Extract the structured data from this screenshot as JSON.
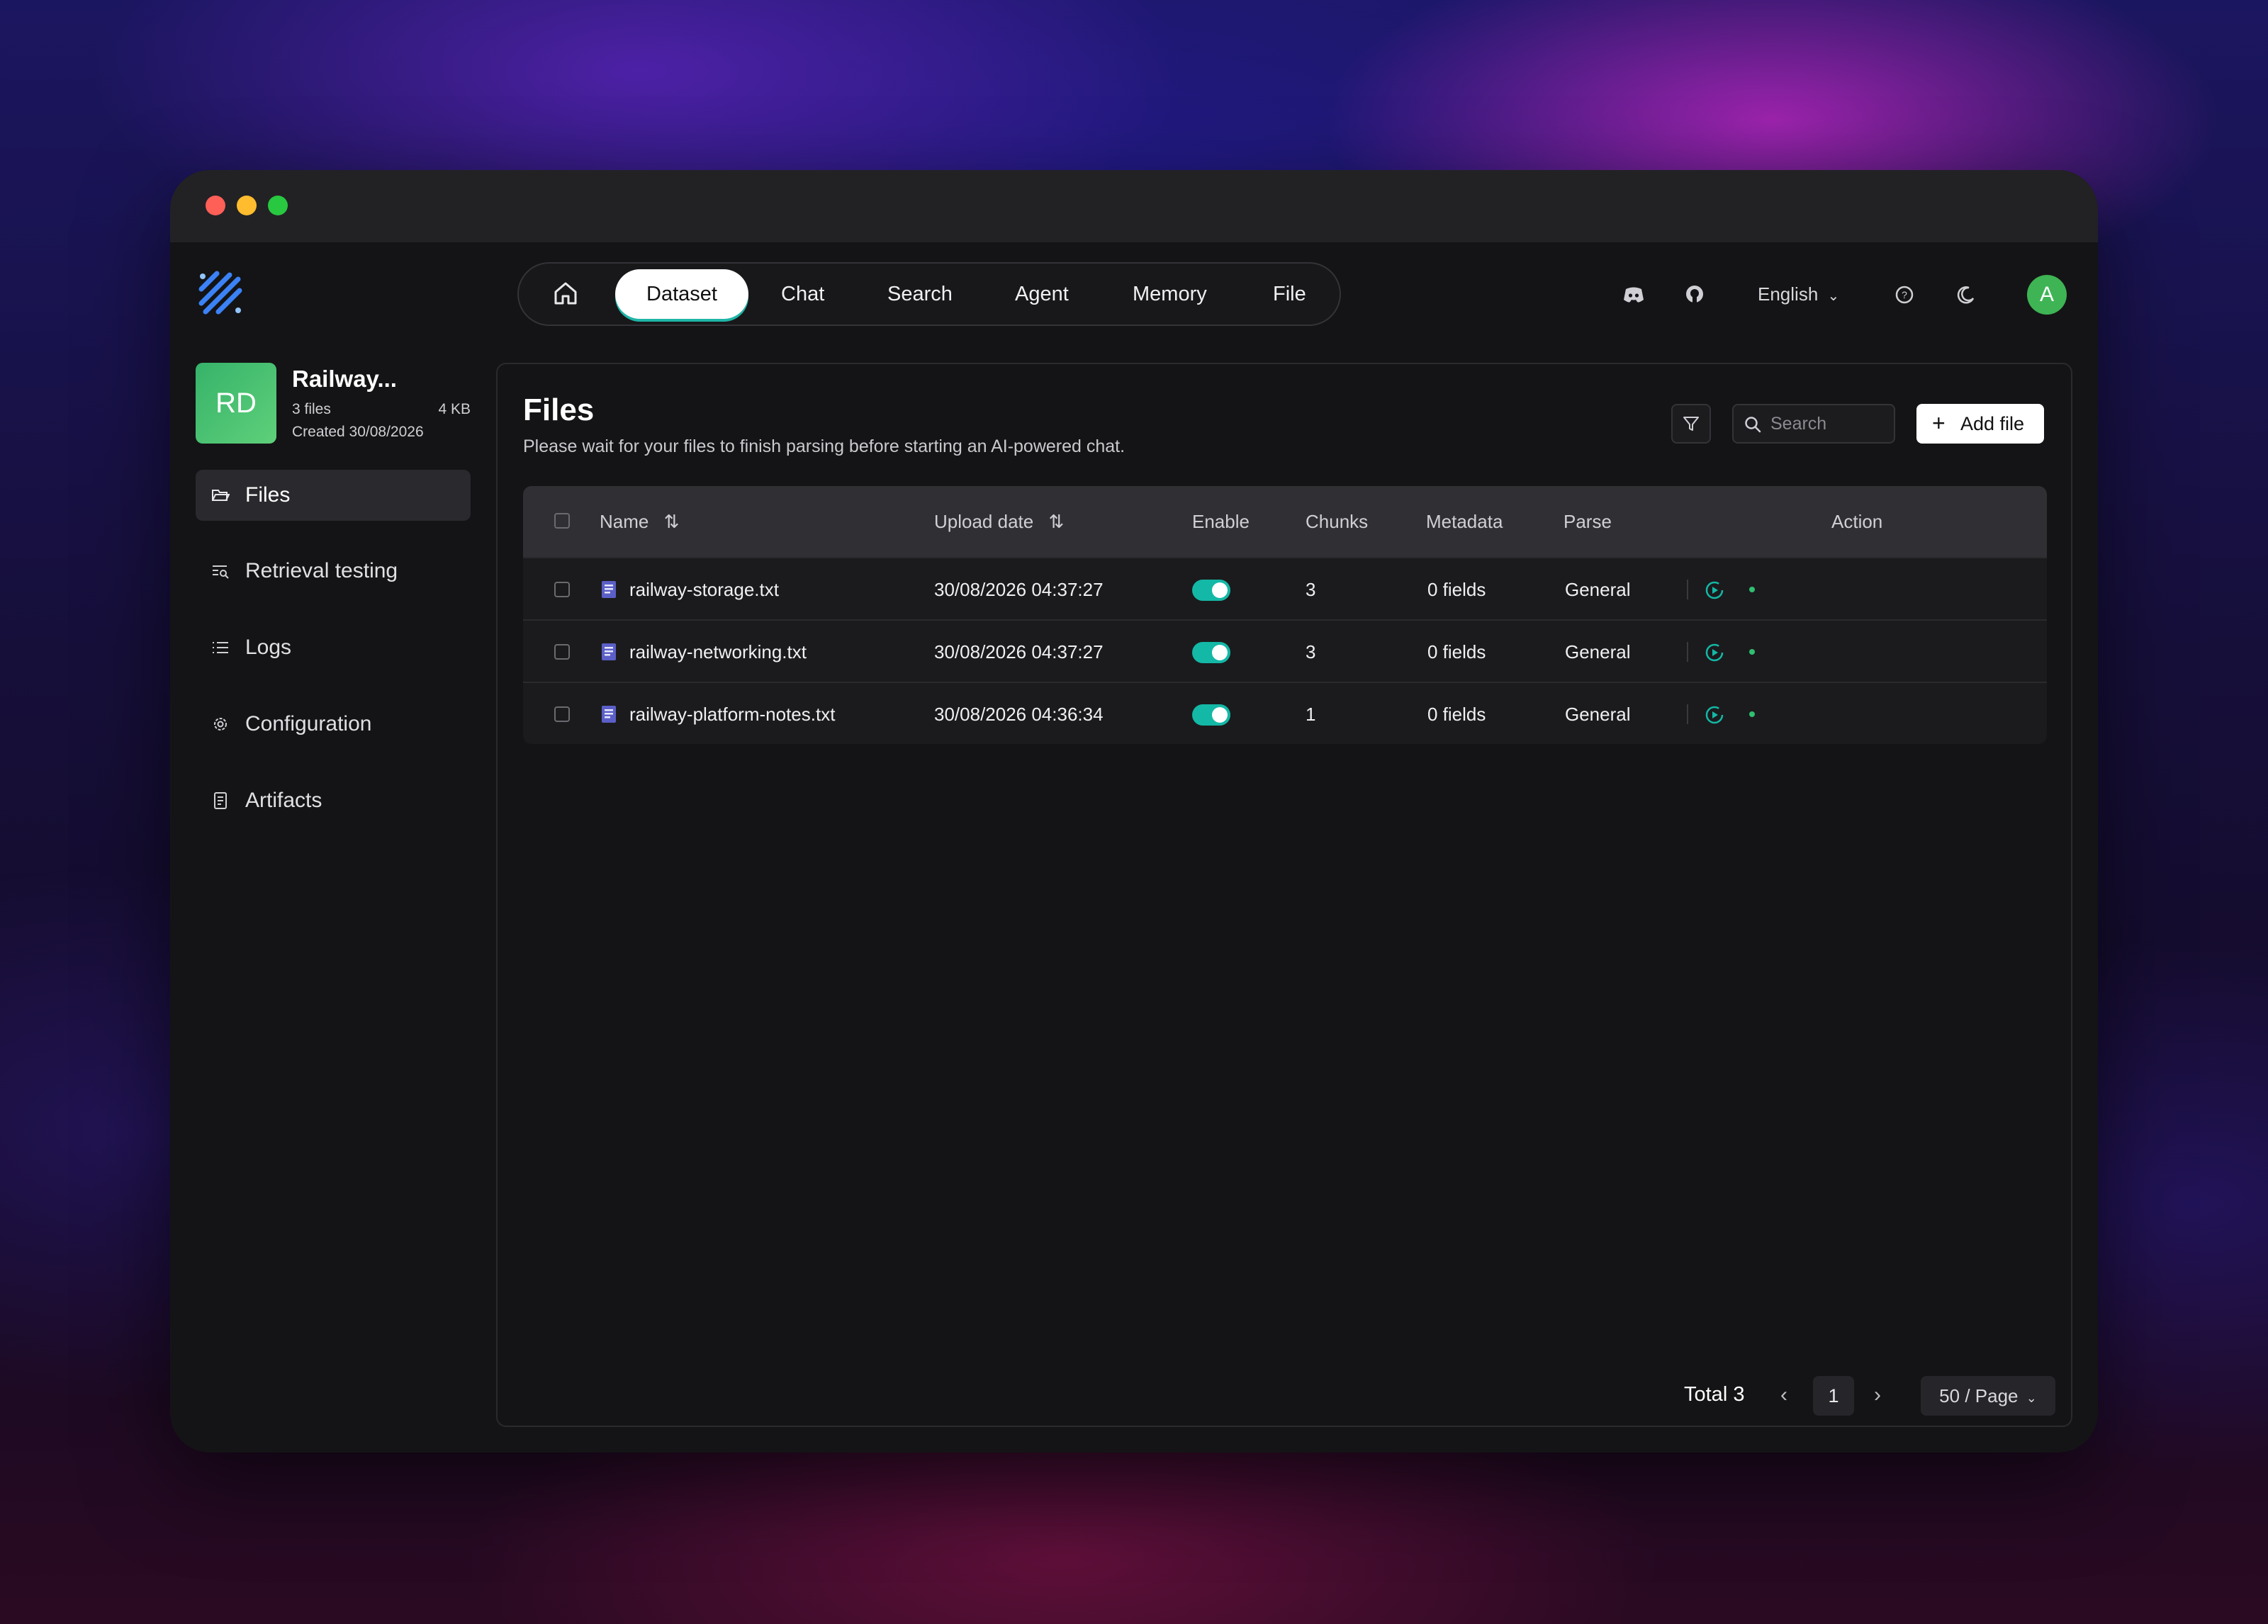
{
  "nav": {
    "items": [
      "Dataset",
      "Chat",
      "Search",
      "Agent",
      "Memory",
      "File"
    ],
    "active": "Dataset",
    "language": "English",
    "avatar_letter": "A"
  },
  "dataset": {
    "avatar_initials": "RD",
    "name": "Railway...",
    "file_count": "3 files",
    "size": "4 KB",
    "created": "Created 30/08/2026"
  },
  "sidebar": {
    "items": [
      {
        "label": "Files",
        "icon": "folder-open-icon"
      },
      {
        "label": "Retrieval testing",
        "icon": "retrieval-icon"
      },
      {
        "label": "Logs",
        "icon": "list-icon"
      },
      {
        "label": "Configuration",
        "icon": "gear-icon"
      },
      {
        "label": "Artifacts",
        "icon": "document-icon"
      }
    ]
  },
  "main": {
    "title": "Files",
    "subtitle": "Please wait for your files to finish parsing before starting an AI-powered chat.",
    "search_placeholder": "Search",
    "add_label": "Add file"
  },
  "table": {
    "headers": {
      "name": "Name",
      "upload_date": "Upload date",
      "enable": "Enable",
      "chunks": "Chunks",
      "metadata": "Metadata",
      "parse": "Parse",
      "action": "Action"
    },
    "rows": [
      {
        "name": "railway-storage.txt",
        "upload_date": "30/08/2026 04:37:27",
        "enabled": true,
        "chunks": "3",
        "metadata": "0 fields",
        "parse": "General"
      },
      {
        "name": "railway-networking.txt",
        "upload_date": "30/08/2026 04:37:27",
        "enabled": true,
        "chunks": "3",
        "metadata": "0 fields",
        "parse": "General"
      },
      {
        "name": "railway-platform-notes.txt",
        "upload_date": "30/08/2026 04:36:34",
        "enabled": true,
        "chunks": "1",
        "metadata": "0 fields",
        "parse": "General"
      }
    ]
  },
  "pagination": {
    "total": "Total 3",
    "current_page": "1",
    "page_size": "50 / Page"
  },
  "colors": {
    "accent": "#14b8a6",
    "avatar": "#3eb454"
  }
}
